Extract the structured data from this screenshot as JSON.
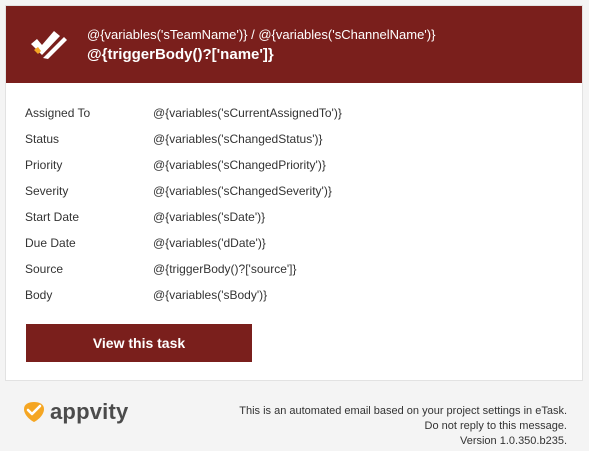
{
  "header": {
    "team_line": "@{variables('sTeamName')} / @{variables('sChannelName')}",
    "title": "@{triggerBody()?['name']}"
  },
  "details": [
    {
      "label": "Assigned To",
      "value": "@{variables('sCurrentAssignedTo')}"
    },
    {
      "label": "Status",
      "value": "@{variables('sChangedStatus')}"
    },
    {
      "label": "Priority",
      "value": "@{variables('sChangedPriority')}"
    },
    {
      "label": "Severity",
      "value": "@{variables('sChangedSeverity')}"
    },
    {
      "label": "Start Date",
      "value": "@{variables('sDate')}"
    },
    {
      "label": "Due Date",
      "value": "@{variables('dDate')}"
    },
    {
      "label": "Source",
      "value": "@{triggerBody()?['source']}"
    },
    {
      "label": "Body",
      "value": "@{variables('sBody')}"
    }
  ],
  "button": {
    "label": "View this task"
  },
  "footer": {
    "brand": "appvity",
    "note_line1": "This is an automated email based on your project settings in eTask.",
    "note_line2": "Do not reply to this message.",
    "note_line3": "Version 1.0.350.b235."
  },
  "colors": {
    "accent": "#7a1f1c",
    "logo_orange": "#f5a623"
  },
  "icons": {
    "header": "etask-checklist-icon",
    "footer": "appvity-logo-icon"
  }
}
